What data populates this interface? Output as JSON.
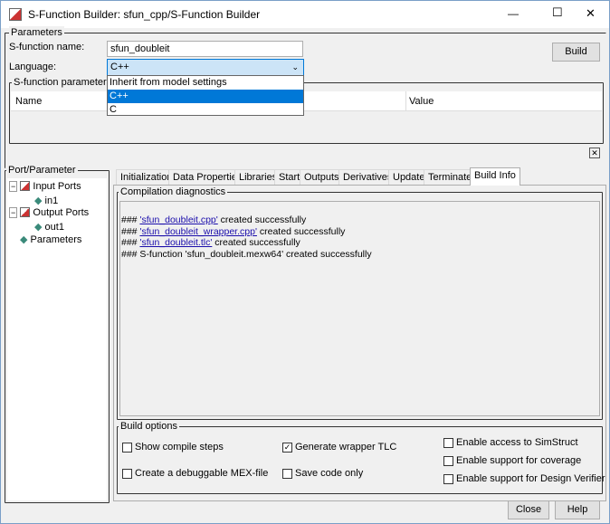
{
  "window": {
    "title": "S-Function Builder: sfun_cpp/S-Function Builder",
    "minimize": "—",
    "maximize": "☐",
    "close": "✕"
  },
  "parameters": {
    "group_label": "Parameters",
    "name_label": "S-function name:",
    "name_value": "sfun_doubleit",
    "language_label": "Language:",
    "language_value": "C++",
    "language_options": [
      "Inherit from model settings",
      "C++",
      "C"
    ],
    "build_button": "Build"
  },
  "sfun_params": {
    "group_label": "S-function parameters",
    "col_name": "Name",
    "col_value": "Value",
    "close_small": "✕"
  },
  "port_panel": {
    "group_label": "Port/Parameter",
    "items": [
      "Input Ports",
      "in1",
      "Output Ports",
      "out1",
      "Parameters"
    ]
  },
  "tabs": [
    "Initialization",
    "Data Properties",
    "Libraries",
    "Start",
    "Outputs",
    "Derivatives",
    "Update",
    "Terminate",
    "Build Info"
  ],
  "diagnostics": {
    "group_label": "Compilation diagnostics",
    "lines": [
      {
        "prefix": "### ",
        "link": "'sfun_doubleit.cpp'",
        "suffix": " created successfully"
      },
      {
        "prefix": "### ",
        "link": "'sfun_doubleit_wrapper.cpp'",
        "suffix": " created successfully"
      },
      {
        "prefix": "### ",
        "link": "'sfun_doubleit.tlc'",
        "suffix": " created successfully"
      },
      {
        "prefix": "### S-function 'sfun_doubleit.mexw64' created successfully",
        "link": "",
        "suffix": ""
      }
    ]
  },
  "build_options": {
    "group_label": "Build options",
    "show_compile": "Show compile steps",
    "debug_mex": "Create a debuggable MEX-file",
    "gen_tlc": "Generate wrapper TLC",
    "save_code": "Save code only",
    "simstruct": "Enable access to SimStruct",
    "coverage": "Enable support for coverage",
    "verifier": "Enable support for Design Verifier"
  },
  "footer": {
    "close": "Close",
    "help": "Help"
  }
}
